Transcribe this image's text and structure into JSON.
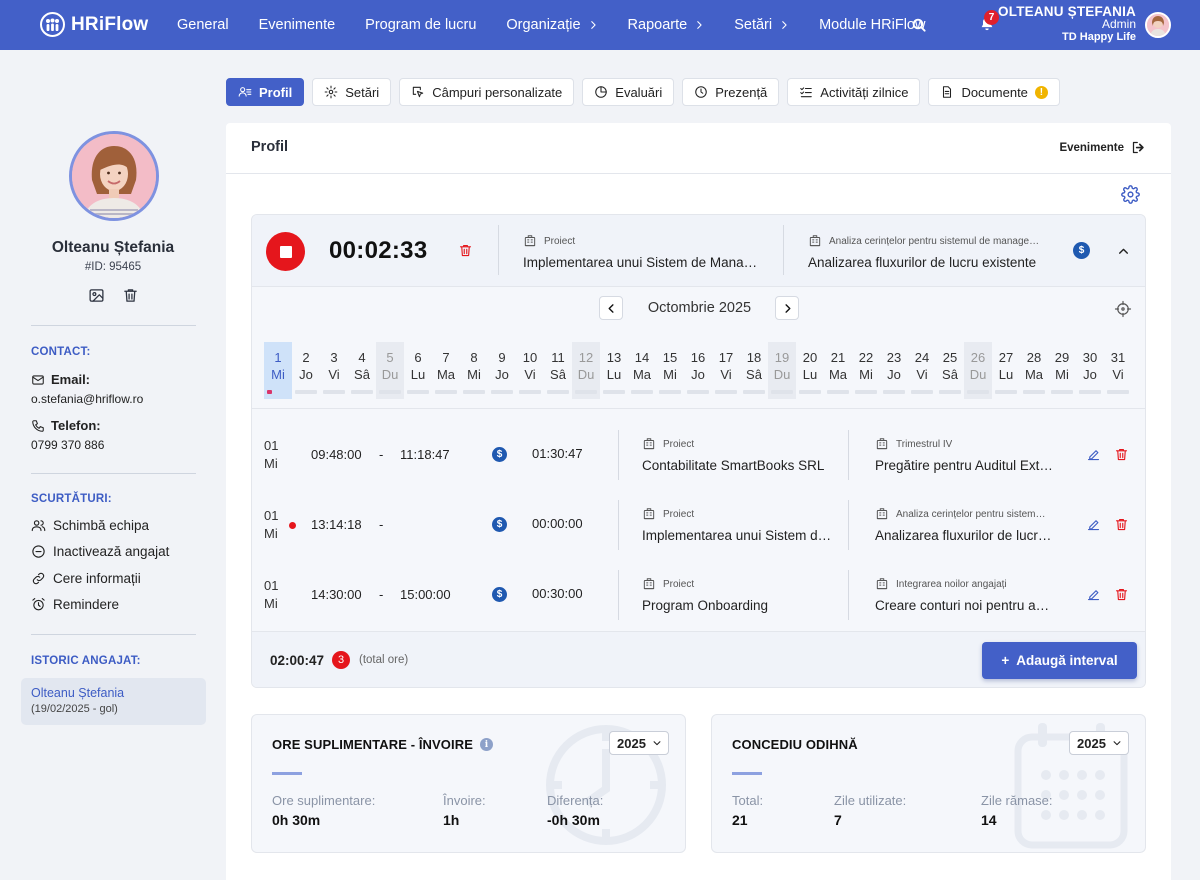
{
  "app": {
    "brand": "HRiFlow"
  },
  "nav": {
    "items": [
      {
        "label": "General",
        "chevron": false
      },
      {
        "label": "Evenimente",
        "chevron": false
      },
      {
        "label": "Program de lucru",
        "chevron": false
      },
      {
        "label": "Organizație",
        "chevron": true
      },
      {
        "label": "Rapoarte",
        "chevron": true
      },
      {
        "label": "Setări",
        "chevron": true
      },
      {
        "label": "Module HRiFlow",
        "chevron": false
      }
    ],
    "notifications": "7"
  },
  "user": {
    "name": "OLTEANU ȘTEFANIA",
    "role": "Admin",
    "company": "TD Happy Life"
  },
  "profile": {
    "name": "Olteanu Ștefania",
    "id": "#ID: 95465",
    "contact_title": "CONTACT:",
    "email_label": "Email:",
    "email": "o.stefania@hriflow.ro",
    "phone_label": "Telefon:",
    "phone": "0799 370 886",
    "shortcuts_title": "SCURTĂTURI:",
    "shortcuts": [
      "Schimbă echipa",
      "Inactivează angajat",
      "Cere informații",
      "Remindere"
    ],
    "history_title": "ISTORIC ANGAJAT:",
    "history": {
      "name": "Olteanu Ștefania",
      "period": "(19/02/2025 - gol)"
    }
  },
  "tabs": [
    "Profil",
    "Setări",
    "Câmpuri personalizate",
    "Evaluări",
    "Prezență",
    "Activități zilnice",
    "Documente"
  ],
  "panel": {
    "title": "Profil",
    "events_link": "Evenimente"
  },
  "timer": {
    "elapsed": "00:02:33",
    "project_label": "Proiect",
    "project": "Implementarea unui Sistem de Management al Proiectelor",
    "task_label": "Analiza cerințelor pentru sistemul de management",
    "task": "Analizarea fluxurilor de lucru existente"
  },
  "calendar": {
    "month": "Octombrie 2025",
    "days": [
      {
        "n": "1",
        "w": "Mi"
      },
      {
        "n": "2",
        "w": "Jo"
      },
      {
        "n": "3",
        "w": "Vi"
      },
      {
        "n": "4",
        "w": "Sâ"
      },
      {
        "n": "5",
        "w": "Du"
      },
      {
        "n": "6",
        "w": "Lu"
      },
      {
        "n": "7",
        "w": "Ma"
      },
      {
        "n": "8",
        "w": "Mi"
      },
      {
        "n": "9",
        "w": "Jo"
      },
      {
        "n": "10",
        "w": "Vi"
      },
      {
        "n": "11",
        "w": "Sâ"
      },
      {
        "n": "12",
        "w": "Du"
      },
      {
        "n": "13",
        "w": "Lu"
      },
      {
        "n": "14",
        "w": "Ma"
      },
      {
        "n": "15",
        "w": "Mi"
      },
      {
        "n": "16",
        "w": "Jo"
      },
      {
        "n": "17",
        "w": "Vi"
      },
      {
        "n": "18",
        "w": "Sâ"
      },
      {
        "n": "19",
        "w": "Du"
      },
      {
        "n": "20",
        "w": "Lu"
      },
      {
        "n": "21",
        "w": "Ma"
      },
      {
        "n": "22",
        "w": "Mi"
      },
      {
        "n": "23",
        "w": "Jo"
      },
      {
        "n": "24",
        "w": "Vi"
      },
      {
        "n": "25",
        "w": "Sâ"
      },
      {
        "n": "26",
        "w": "Du"
      },
      {
        "n": "27",
        "w": "Lu"
      },
      {
        "n": "28",
        "w": "Ma"
      },
      {
        "n": "29",
        "w": "Mi"
      },
      {
        "n": "30",
        "w": "Jo"
      },
      {
        "n": "31",
        "w": "Vi"
      }
    ],
    "selected_day": "1"
  },
  "entries": [
    {
      "day": "01",
      "weekday": "Mi",
      "running": false,
      "start": "09:48:00",
      "dash": "-",
      "end": "11:18:47",
      "duration": "01:30:47",
      "project_label": "Proiect",
      "project": "Contabilitate SmartBooks SRL",
      "task_label": "Trimestrul IV",
      "task": "Pregătire pentru Auditul Extern"
    },
    {
      "day": "01",
      "weekday": "Mi",
      "running": true,
      "start": "13:14:18",
      "dash": "-",
      "end": "",
      "duration": "00:00:00",
      "project_label": "Proiect",
      "project": "Implementarea unui Sistem de Management",
      "task_label": "Analiza cerințelor pentru sistemul de management",
      "task": "Analizarea fluxurilor de lucru existente"
    },
    {
      "day": "01",
      "weekday": "Mi",
      "running": false,
      "start": "14:30:00",
      "dash": "-",
      "end": "15:00:00",
      "duration": "00:30:00",
      "project_label": "Proiect",
      "project": "Program Onboarding",
      "task_label": "Integrarea noilor angajați",
      "task": "Creare conturi noi pentru angajați"
    }
  ],
  "totals": {
    "time": "02:00:47",
    "count": "3",
    "label": "(total ore)",
    "add_button": "Adaugă interval",
    "add_plus": "+"
  },
  "overtime": {
    "title": "ORE SUPLIMENTARE - ÎNVOIRE",
    "year": "2025",
    "stats": [
      {
        "label": "Ore suplimentare:",
        "value": "0h 30m"
      },
      {
        "label": "Învoire:",
        "value": "1h"
      },
      {
        "label": "Diferența:",
        "value": "-0h 30m"
      }
    ]
  },
  "leave": {
    "title": "CONCEDIU ODIHNĂ",
    "year": "2025",
    "stats": [
      {
        "label": "Total:",
        "value": "21"
      },
      {
        "label": "Zile utilizate:",
        "value": "7"
      },
      {
        "label": "Zile rămase:",
        "value": "14"
      }
    ]
  },
  "colors": {
    "primary": "#4360c8",
    "danger": "#e5161c",
    "accent": "#3d5cc4",
    "money": "#1f59b0"
  }
}
